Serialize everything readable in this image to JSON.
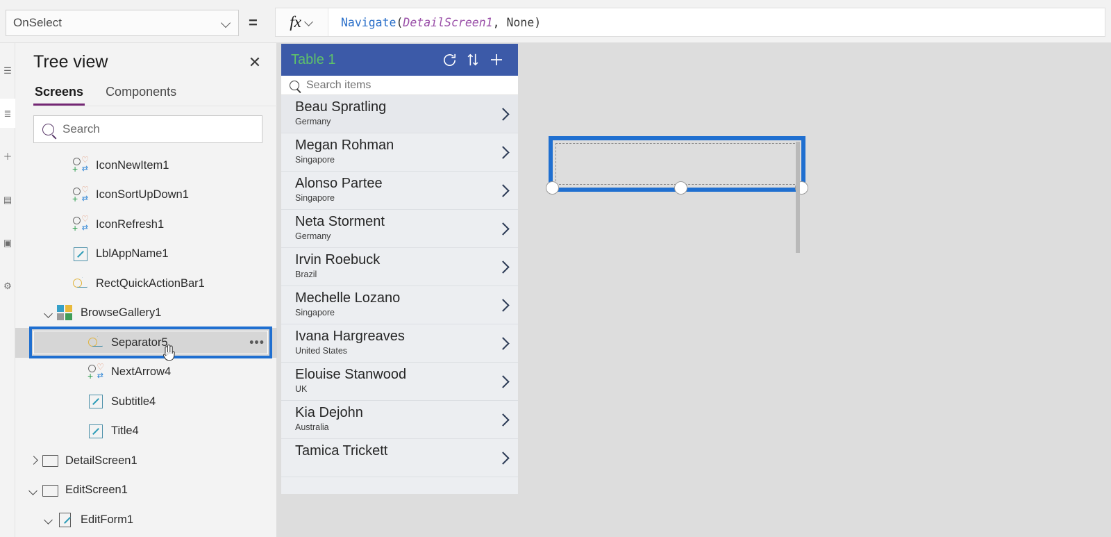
{
  "colors": {
    "accent_purple": "#742774",
    "selection_blue": "#1f6fd0",
    "app_header_blue": "#3c5aa8",
    "app_title_green": "#5ec16a"
  },
  "formula_bar": {
    "property_value": "OnSelect",
    "equals_sign": "=",
    "fx_label": "fx",
    "formula_tokens": [
      {
        "text": "Navigate",
        "type": "function"
      },
      {
        "text": "(",
        "type": "punctuation"
      },
      {
        "text": "DetailScreen1",
        "type": "identifier"
      },
      {
        "text": ", ",
        "type": "punctuation"
      },
      {
        "text": "None",
        "type": "keyword"
      },
      {
        "text": ")",
        "type": "punctuation"
      }
    ],
    "formula_plain": "Navigate(DetailScreen1, None)"
  },
  "left_rail": {
    "items": [
      {
        "icon": "menu-icon",
        "glyph": "☰",
        "active": false
      },
      {
        "icon": "tree-view-icon",
        "glyph": "≣",
        "active": true
      },
      {
        "icon": "insert-icon",
        "glyph": "＋",
        "active": false
      },
      {
        "icon": "data-icon",
        "glyph": "▤",
        "active": false
      },
      {
        "icon": "media-icon",
        "glyph": "▣",
        "active": false
      },
      {
        "icon": "advanced-icon",
        "glyph": "⚙",
        "active": false
      }
    ]
  },
  "tree_view": {
    "title": "Tree view",
    "close_label": "✕",
    "tabs": [
      {
        "label": "Screens",
        "active": true
      },
      {
        "label": "Components",
        "active": false
      }
    ],
    "search_placeholder": "Search",
    "search_value": "",
    "items": [
      {
        "label": "IconNewItem1",
        "icon": "control-icon",
        "indent": 2,
        "twisty": "none",
        "selected": false
      },
      {
        "label": "IconSortUpDown1",
        "icon": "control-icon",
        "indent": 2,
        "twisty": "none",
        "selected": false
      },
      {
        "label": "IconRefresh1",
        "icon": "control-icon",
        "indent": 2,
        "twisty": "none",
        "selected": false
      },
      {
        "label": "LblAppName1",
        "icon": "label-icon",
        "indent": 2,
        "twisty": "none",
        "selected": false
      },
      {
        "label": "RectQuickActionBar1",
        "icon": "shape-icon",
        "indent": 2,
        "twisty": "none",
        "selected": false
      },
      {
        "label": "BrowseGallery1",
        "icon": "gallery-icon",
        "indent": 1,
        "twisty": "down",
        "selected": false
      },
      {
        "label": "Separator5",
        "icon": "shape-icon",
        "indent": 3,
        "twisty": "none",
        "selected": true,
        "more_menu": "•••"
      },
      {
        "label": "NextArrow4",
        "icon": "control-icon",
        "indent": 3,
        "twisty": "none",
        "selected": false
      },
      {
        "label": "Subtitle4",
        "icon": "label-icon",
        "indent": 3,
        "twisty": "none",
        "selected": false
      },
      {
        "label": "Title4",
        "icon": "label-icon",
        "indent": 3,
        "twisty": "none",
        "selected": false
      },
      {
        "label": "DetailScreen1",
        "icon": "screen-icon",
        "indent": 0,
        "twisty": "right",
        "selected": false
      },
      {
        "label": "EditScreen1",
        "icon": "screen-icon",
        "indent": 0,
        "twisty": "down",
        "selected": false
      },
      {
        "label": "EditForm1",
        "icon": "form-icon",
        "indent": 1,
        "twisty": "down",
        "selected": false
      }
    ]
  },
  "app_preview": {
    "header": {
      "title": "Table 1",
      "actions": [
        {
          "name": "refresh-icon",
          "glyph": "↻"
        },
        {
          "name": "sort-icon",
          "glyph": "⇅"
        },
        {
          "name": "add-icon",
          "glyph": "＋"
        }
      ]
    },
    "search_placeholder": "Search items",
    "search_value": "",
    "gallery_items": [
      {
        "name": "Beau Spratling",
        "country": "Germany",
        "selected": true
      },
      {
        "name": "Megan Rohman",
        "country": "Singapore",
        "selected": false
      },
      {
        "name": "Alonso Partee",
        "country": "Singapore",
        "selected": false
      },
      {
        "name": "Neta Storment",
        "country": "Germany",
        "selected": false
      },
      {
        "name": "Irvin Roebuck",
        "country": "Brazil",
        "selected": false
      },
      {
        "name": "Mechelle Lozano",
        "country": "Singapore",
        "selected": false
      },
      {
        "name": "Ivana Hargreaves",
        "country": "United States",
        "selected": false
      },
      {
        "name": "Elouise Stanwood",
        "country": "UK",
        "selected": false
      },
      {
        "name": "Kia Dejohn",
        "country": "Australia",
        "selected": false
      },
      {
        "name": "Tamica Trickett",
        "country": "",
        "selected": false
      }
    ]
  }
}
